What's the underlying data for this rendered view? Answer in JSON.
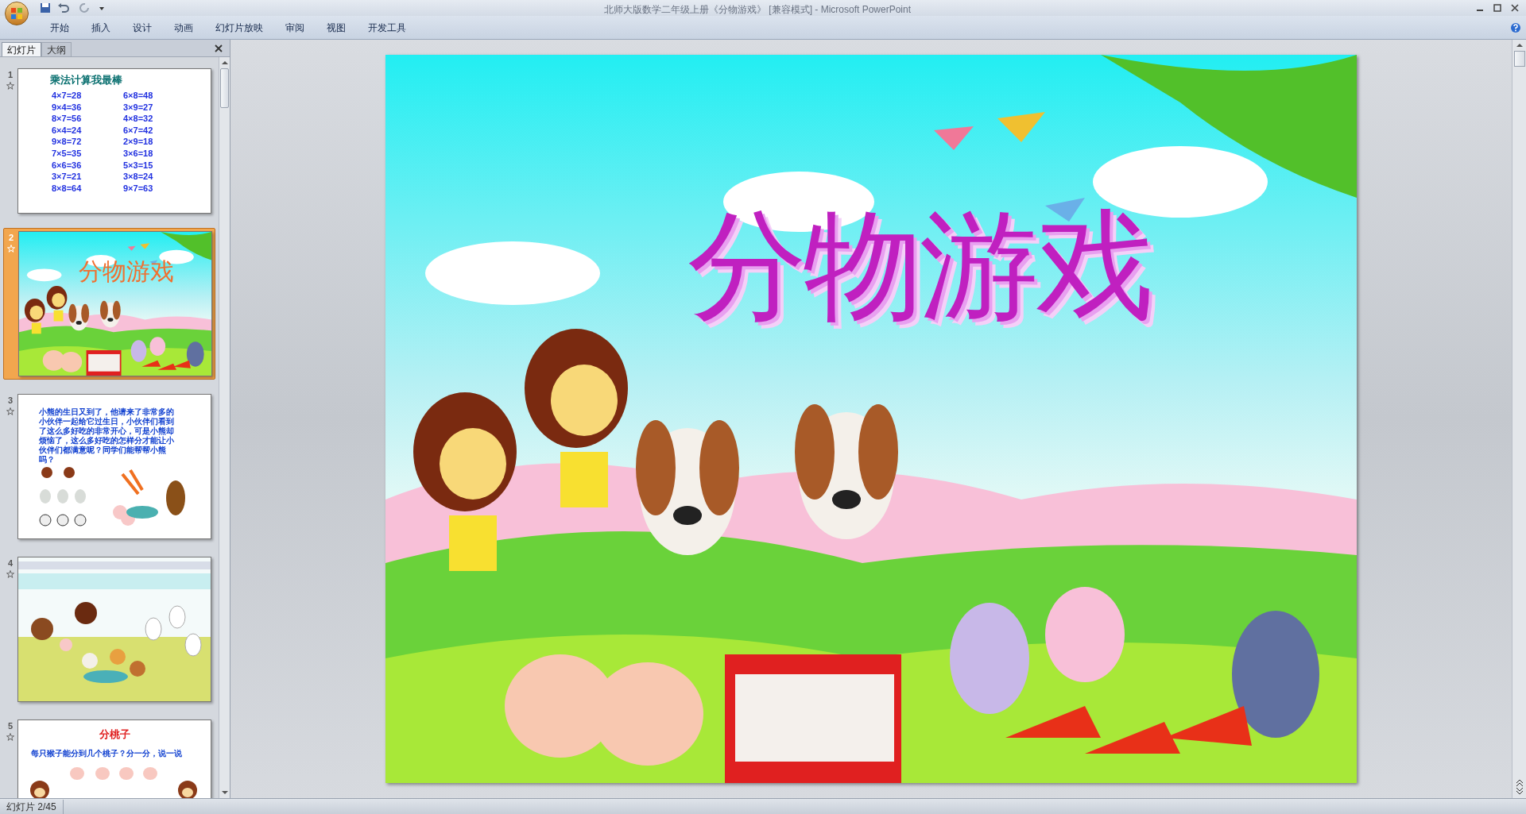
{
  "window": {
    "title": "北师大版数学二年级上册《分物游戏》 [兼容模式] - Microsoft PowerPoint"
  },
  "ribbon_tabs": [
    {
      "label": "开始",
      "selected": false
    },
    {
      "label": "插入",
      "selected": false
    },
    {
      "label": "设计",
      "selected": false
    },
    {
      "label": "动画",
      "selected": false
    },
    {
      "label": "幻灯片放映",
      "selected": false
    },
    {
      "label": "审阅",
      "selected": false
    },
    {
      "label": "视图",
      "selected": false
    },
    {
      "label": "开发工具",
      "selected": false
    }
  ],
  "panel_tabs": [
    {
      "label": "幻灯片",
      "selected": true
    },
    {
      "label": "大纲",
      "selected": false
    }
  ],
  "slides": [
    {
      "number": "1",
      "selected": false,
      "kind": "equations",
      "title": "乘法计算我最棒",
      "left_column": [
        "4×7=28",
        "9×4=36",
        "8×7=56",
        "6×4=24",
        "9×8=72",
        "7×5=35",
        "6×6=36",
        "3×7=21",
        "8×8=64"
      ],
      "right_column": [
        "6×8=48",
        "3×9=27",
        "4×8=32",
        "6×7=42",
        "2×9=18",
        "3×6=18",
        "5×3=15",
        "3×8=24",
        "9×7=63"
      ]
    },
    {
      "number": "2",
      "selected": true,
      "kind": "title_picture",
      "title": "分物游戏"
    },
    {
      "number": "3",
      "selected": false,
      "kind": "story",
      "text": "小熊的生日又到了，他请来了非常多的小伙伴一起给它过生日，小伙伴们看到了这么多好吃的非常开心，可是小熊却烦恼了，这么多好吃的怎样分才能让小伙伴们都满意呢？同学们能帮帮小熊吗？"
    },
    {
      "number": "4",
      "selected": false,
      "kind": "picture"
    },
    {
      "number": "5",
      "selected": false,
      "kind": "heading",
      "title": "分桃子",
      "subtitle": "每只猴子能分到几个桃子？分一分，说一说"
    }
  ],
  "main_slide": {
    "title": "分物游戏"
  },
  "status_bar": {
    "slide_indicator": "幻灯片 2/45"
  }
}
